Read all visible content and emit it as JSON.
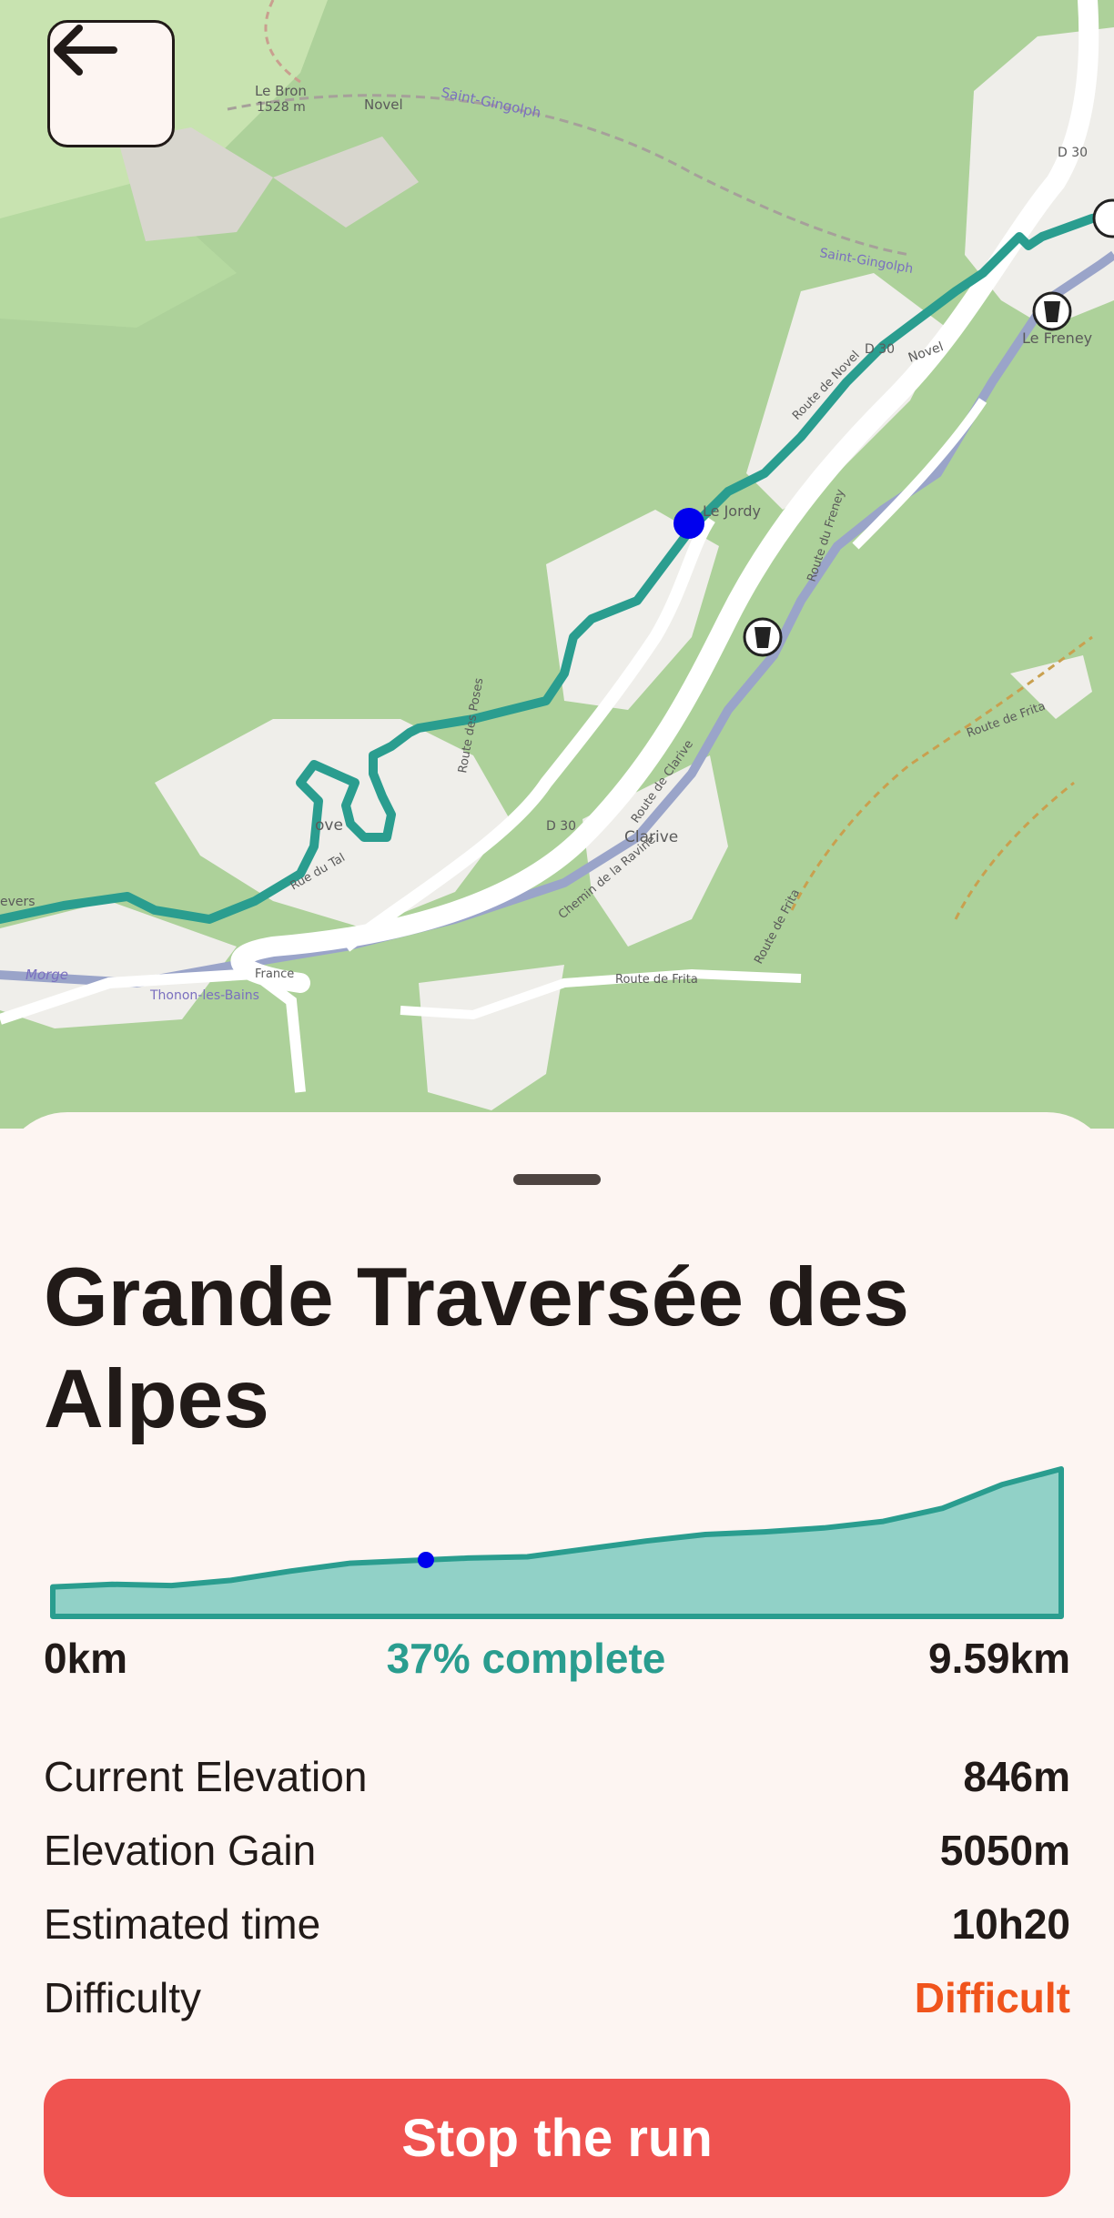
{
  "map": {
    "icons": [
      "back-arrow-icon",
      "drinking-water-icon",
      "current-position-marker"
    ],
    "place_labels": [
      "Le Bron",
      "1528 m",
      "Novel",
      "Saint-Gingolph",
      "Le Jordy",
      "Le Freney",
      "Clarive",
      "Novel",
      "Saint-Gingolph",
      "D 30",
      "D 30",
      "D 30",
      "France",
      "Route de Novel",
      "Route du Freney",
      "Route des Poses",
      "Route de Clarive",
      "Chemin de la Ravine",
      "Route de Frita",
      "Route de Frita",
      "Route de Frita",
      "Rue du Tal",
      "Thonon-les-Bains",
      "Morge",
      "evers",
      "ove"
    ],
    "route_color": "#2a9d8f",
    "marker_color": "#0000ee"
  },
  "run": {
    "title": "Grande Traversée des Alpes",
    "start_km": "0km",
    "progress_text": "37% complete",
    "end_km": "9.59km",
    "progress_fraction": 0.37
  },
  "stats": {
    "current_elevation": {
      "label": "Current Elevation",
      "value": "846m"
    },
    "elevation_gain": {
      "label": "Elevation Gain",
      "value": "5050m"
    },
    "estimated_time": {
      "label": "Estimated time",
      "value": "10h20"
    },
    "difficulty": {
      "label": "Difficulty",
      "value": "Difficult"
    }
  },
  "actions": {
    "stop_label": "Stop the run"
  },
  "colors": {
    "accent": "#2a9d8f",
    "difficulty": "#f0541c",
    "stop_button": "#ef5350",
    "marker": "#0000ee"
  },
  "elevation_profile": [
    0.1,
    0.12,
    0.11,
    0.15,
    0.22,
    0.28,
    0.3,
    0.32,
    0.33,
    0.39,
    0.45,
    0.5,
    0.52,
    0.55,
    0.6,
    0.7,
    0.88,
    1.0
  ]
}
